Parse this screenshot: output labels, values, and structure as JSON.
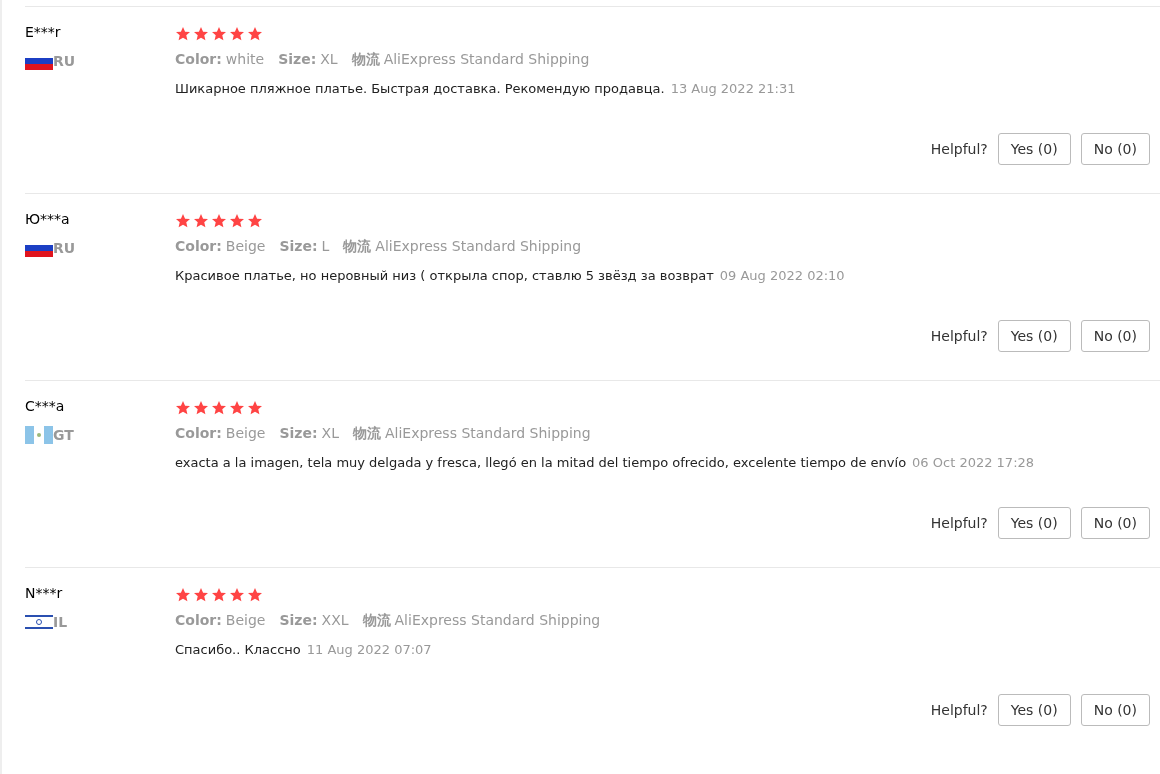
{
  "reviews": [
    {
      "name": "E***r",
      "flag": {
        "kind": "ru"
      },
      "country": "RU",
      "stars": 5,
      "color_label": "Color:",
      "color_value": "white",
      "size_label": "Size:",
      "size": "XL",
      "shipping_label": "物流",
      "shipping": "AliExpress Standard Shipping",
      "text": "Шикарное пляжное платье. Быстрая доставка. Рекомендую продавца.",
      "date": "13 Aug 2022 21:31",
      "helpful": "Helpful?",
      "yes": "Yes (0)",
      "no": "No (0)"
    },
    {
      "name": "Ю***a",
      "flag": {
        "kind": "ru"
      },
      "country": "RU",
      "stars": 5,
      "color_label": "Color:",
      "color_value": "Beige",
      "size_label": "Size:",
      "size": "L",
      "shipping_label": "物流",
      "shipping": "AliExpress Standard Shipping",
      "text": "Красивое платье, но неровный низ ( открыла спор, ставлю 5 звёзд за возврат",
      "date": "09 Aug 2022 02:10",
      "helpful": "Helpful?",
      "yes": "Yes (0)",
      "no": "No (0)"
    },
    {
      "name": "C***a",
      "flag": {
        "kind": "gt"
      },
      "country": "GT",
      "stars": 5,
      "color_label": "Color:",
      "color_value": "Beige",
      "size_label": "Size:",
      "size": "XL",
      "shipping_label": "物流",
      "shipping": "AliExpress Standard Shipping",
      "text": "exacta a la imagen, tela muy delgada y fresca, llegó en la mitad del tiempo ofrecido, excelente tiempo de envío",
      "date": "06 Oct 2022 17:28",
      "helpful": "Helpful?",
      "yes": "Yes (0)",
      "no": "No (0)"
    },
    {
      "name": "N***r",
      "flag": {
        "kind": "il"
      },
      "country": "IL",
      "stars": 5,
      "color_label": "Color:",
      "color_value": "Beige",
      "size_label": "Size:",
      "size": "XXL",
      "shipping_label": "物流",
      "shipping": "AliExpress Standard Shipping",
      "text": "Спасибо.. Классно",
      "date": "11 Aug 2022 07:07",
      "helpful": "Helpful?",
      "yes": "Yes (0)",
      "no": "No (0)"
    }
  ]
}
